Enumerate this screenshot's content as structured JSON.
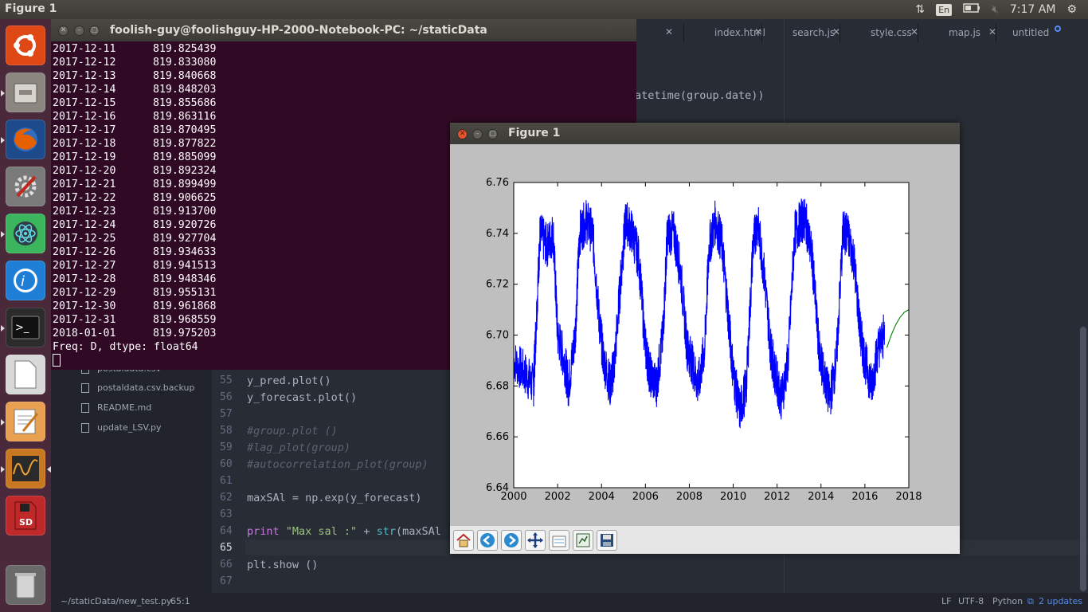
{
  "top_panel": {
    "title": "Figure 1",
    "lang": "En",
    "time": "7:17 AM",
    "icons": [
      "network-icon",
      "keyboard-lang-icon",
      "battery-icon",
      "volume-muted-icon",
      "gear-icon"
    ]
  },
  "launcher": {
    "items": [
      {
        "name": "ubuntu-dash-icon",
        "color": "#dd4814"
      },
      {
        "name": "files-icon",
        "color": "#8b8680"
      },
      {
        "name": "firefox-icon",
        "color": "#e66000"
      },
      {
        "name": "system-settings-icon",
        "color": "#b03020"
      },
      {
        "name": "atom-icon",
        "color": "#3cb55f"
      },
      {
        "name": "pycharm-icon",
        "color": "#1f7fd6"
      },
      {
        "name": "terminal-icon",
        "color": "#2c2c2c"
      },
      {
        "name": "libreoffice-icon",
        "color": "#d8d8d8"
      },
      {
        "name": "text-editor-icon",
        "color": "#e9a050"
      },
      {
        "name": "system-monitor-icon",
        "color": "#c87820"
      },
      {
        "name": "sd-card-icon",
        "color": "#c0282a"
      },
      {
        "name": "trash-icon",
        "color": "#9a9a9a"
      }
    ],
    "sd_label": "SD"
  },
  "editor": {
    "tabs": [
      "index.html",
      "search.js",
      "style.css",
      "map.js",
      "untitled"
    ],
    "partial_code": "atetime(group.date))",
    "tree": [
      "postaldata.csv",
      "postaldata.csv.backup",
      "README.md",
      "update_LSV.py"
    ],
    "lines": [
      {
        "n": "55",
        "text": "y_pred.plot()"
      },
      {
        "n": "56",
        "text": "y_forecast.plot()"
      },
      {
        "n": "57",
        "text": ""
      },
      {
        "n": "58",
        "text": "#group.plot ()"
      },
      {
        "n": "59",
        "text": "#lag_plot(group)"
      },
      {
        "n": "60",
        "text": "#autocorrelation_plot(group)"
      },
      {
        "n": "61",
        "text": ""
      },
      {
        "n": "62",
        "text": "maxSAl = np.exp(y_forecast)"
      },
      {
        "n": "63",
        "text": ""
      },
      {
        "n": "64",
        "print": "print",
        "str": "\"Max sal :\"",
        "rest": " + ",
        "fn": "str",
        "tail": "(maxSAl"
      },
      {
        "n": "65",
        "text": ""
      },
      {
        "n": "66",
        "text": "plt.show ()"
      },
      {
        "n": "67",
        "text": ""
      }
    ]
  },
  "statusbar": {
    "path": "~/staticData/new_test.py",
    "cursor": "65:1",
    "line_ending": "LF",
    "encoding": "UTF-8",
    "grammar": "Python",
    "updates": "2 updates"
  },
  "terminal": {
    "title": "foolish-guy@foolishguy-HP-2000-Notebook-PC: ~/staticData",
    "rows": [
      [
        "2017-12-11",
        "819.825439"
      ],
      [
        "2017-12-12",
        "819.833080"
      ],
      [
        "2017-12-13",
        "819.840668"
      ],
      [
        "2017-12-14",
        "819.848203"
      ],
      [
        "2017-12-15",
        "819.855686"
      ],
      [
        "2017-12-16",
        "819.863116"
      ],
      [
        "2017-12-17",
        "819.870495"
      ],
      [
        "2017-12-18",
        "819.877822"
      ],
      [
        "2017-12-19",
        "819.885099"
      ],
      [
        "2017-12-20",
        "819.892324"
      ],
      [
        "2017-12-21",
        "819.899499"
      ],
      [
        "2017-12-22",
        "819.906625"
      ],
      [
        "2017-12-23",
        "819.913700"
      ],
      [
        "2017-12-24",
        "819.920726"
      ],
      [
        "2017-12-25",
        "819.927704"
      ],
      [
        "2017-12-26",
        "819.934633"
      ],
      [
        "2017-12-27",
        "819.941513"
      ],
      [
        "2017-12-28",
        "819.948346"
      ],
      [
        "2017-12-29",
        "819.955131"
      ],
      [
        "2017-12-30",
        "819.961868"
      ],
      [
        "2017-12-31",
        "819.968559"
      ],
      [
        "2018-01-01",
        "819.975203"
      ]
    ],
    "footer": "Freq: D, dtype: float64"
  },
  "figure": {
    "title": "Figure 1",
    "toolbar": [
      "home-icon",
      "back-icon",
      "forward-icon",
      "pan-icon",
      "subplots-icon",
      "zoom-icon",
      "save-icon"
    ]
  },
  "chart_data": {
    "type": "line",
    "xlim": [
      2000,
      2018
    ],
    "ylim": [
      6.64,
      6.76
    ],
    "xticks": [
      2000,
      2002,
      2004,
      2006,
      2008,
      2010,
      2012,
      2014,
      2016,
      2018
    ],
    "yticks": [
      6.64,
      6.66,
      6.68,
      6.7,
      6.72,
      6.74,
      6.76
    ],
    "ytick_labels": [
      "6.64",
      "6.66",
      "6.68",
      "6.70",
      "6.72",
      "6.74",
      "6.76"
    ],
    "grid": false,
    "series": [
      {
        "color": "#0000ff",
        "x": [
          2000.0,
          2000.5,
          2000.9,
          2001.0,
          2001.2,
          2001.5,
          2001.8,
          2002.0,
          2002.3,
          2002.5,
          2002.8,
          2003.0,
          2003.3,
          2003.6,
          2003.9,
          2004.1,
          2004.4,
          2004.6,
          2004.9,
          2005.1,
          2005.4,
          2005.7,
          2006.0,
          2006.2,
          2006.5,
          2006.8,
          2007.0,
          2007.3,
          2007.6,
          2007.9,
          2008.1,
          2008.4,
          2008.7,
          2008.9,
          2009.2,
          2009.5,
          2009.8,
          2010.0,
          2010.3,
          2010.6,
          2010.9,
          2011.1,
          2011.4,
          2011.7,
          2011.9,
          2012.2,
          2012.5,
          2012.8,
          2013.1,
          2013.3,
          2013.6,
          2013.9,
          2014.1,
          2014.4,
          2014.7,
          2015.0,
          2015.2,
          2015.5,
          2015.8,
          2016.0,
          2016.3,
          2016.6,
          2016.9
        ],
        "y": [
          6.69,
          6.685,
          6.68,
          6.7,
          6.74,
          6.735,
          6.74,
          6.7,
          6.69,
          6.68,
          6.7,
          6.74,
          6.745,
          6.74,
          6.705,
          6.69,
          6.68,
          6.69,
          6.725,
          6.745,
          6.74,
          6.73,
          6.695,
          6.685,
          6.68,
          6.7,
          6.74,
          6.74,
          6.725,
          6.695,
          6.69,
          6.68,
          6.695,
          6.735,
          6.745,
          6.735,
          6.705,
          6.685,
          6.67,
          6.68,
          6.735,
          6.745,
          6.725,
          6.695,
          6.685,
          6.675,
          6.69,
          6.74,
          6.745,
          6.745,
          6.73,
          6.695,
          6.685,
          6.675,
          6.69,
          6.74,
          6.74,
          6.73,
          6.7,
          6.69,
          6.68,
          6.695,
          6.7
        ]
      },
      {
        "color": "#008000",
        "x": [
          2017.0,
          2017.2,
          2017.4,
          2017.6,
          2017.8,
          2018.0
        ],
        "y": [
          6.695,
          6.7,
          6.704,
          6.707,
          6.709,
          6.71
        ]
      }
    ]
  }
}
